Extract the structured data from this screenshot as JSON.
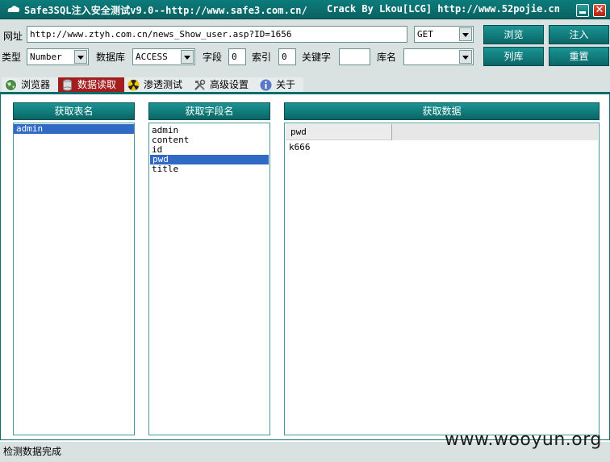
{
  "window": {
    "title": "Safe3SQL注入安全测试v9.0--http://www.safe3.com.cn/",
    "crack": "Crack By Lkou[LCG]  http://www.52pojie.cn",
    "close_glyph": "✕"
  },
  "toolbar": {
    "url_label": "网址",
    "url_value": "http://www.ztyh.com.cn/news_Show_user.asp?ID=1656",
    "method_value": "GET",
    "browse_button": "浏览",
    "inject_button": "注入",
    "type_label": "类型",
    "type_value": "Number",
    "db_label": "数据库",
    "db_value": "ACCESS",
    "field_label": "字段",
    "field_value": "0",
    "index_label": "索引",
    "index_value": "0",
    "keyword_label": "关键字",
    "keyword_value": "",
    "dbname_label": "库名",
    "dbname_value": "",
    "listdb_button": "列库",
    "reset_button": "重置"
  },
  "tabs": [
    {
      "label": "浏览器",
      "icon": "globe-icon",
      "active": false
    },
    {
      "label": "数据读取",
      "icon": "database-icon",
      "active": true
    },
    {
      "label": "渗透测试",
      "icon": "radiation-icon",
      "active": false
    },
    {
      "label": "高级设置",
      "icon": "tools-icon",
      "active": false
    },
    {
      "label": "关于",
      "icon": "info-icon",
      "active": false
    }
  ],
  "panels": {
    "tables": {
      "header": "获取表名",
      "items": [
        "admin"
      ],
      "selected": 0
    },
    "fields": {
      "header": "获取字段名",
      "items": [
        "admin",
        "content",
        "id",
        "pwd",
        "title"
      ],
      "selected": 3
    },
    "data": {
      "header": "获取数据",
      "column": "pwd",
      "rows": [
        "k666"
      ]
    }
  },
  "status": {
    "text": "检测数据完成"
  },
  "watermark": "www.wooyun.org",
  "colors": {
    "teal": "#0d6d6d",
    "selection": "#316ac5",
    "active_tab": "#a31f1f"
  }
}
